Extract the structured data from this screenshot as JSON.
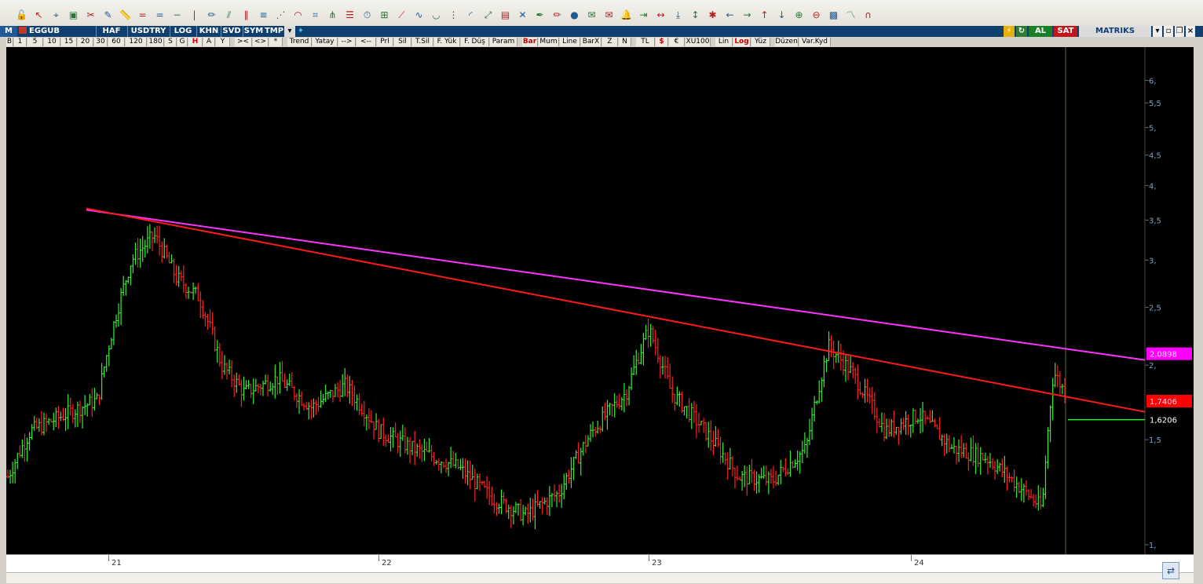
{
  "toolbar": {
    "icons": [
      "lock-open-icon",
      "cursor-icon",
      "cross-icon",
      "box-icon",
      "tools-icon",
      "pencil-icon",
      "ruler-icon",
      "equal-icon",
      "equal-icon",
      "minus-icon",
      "vline-icon",
      "brush-icon",
      "channel-icon",
      "parallel-icon",
      "fib-icon",
      "fib-fan-icon",
      "fib-arc-icon",
      "gann-icon",
      "pitch-icon",
      "retrace-icon",
      "time-icon",
      "grid-icon",
      "speed-icon",
      "wave-icon",
      "cycle-icon",
      "fan-icon",
      "arc-icon",
      "regression-icon",
      "box-zone-icon",
      "cross-lines-icon",
      "pen-icon",
      "brush-icon",
      "marker-icon",
      "note-icon",
      "note2-icon",
      "bell-icon",
      "collapse-h-icon",
      "expand-h-icon",
      "collapse-v-icon",
      "expand-v-icon",
      "star-icon",
      "arrow-left-icon",
      "arrow-right-icon",
      "arrow-up-icon",
      "arrow-down-icon",
      "zoom-in-icon",
      "zoom-out-icon",
      "image-icon",
      "wave-red-icon",
      "arc-red-icon"
    ]
  },
  "titlebar": {
    "m_label": "M",
    "symbol": "EGGUB",
    "period": "HAF",
    "currency": "USDTRY",
    "scale": "LOG",
    "khn": "KHN",
    "svd": "SVD",
    "sym": "SYM",
    "tmp": "TMP",
    "buy": "AL",
    "sell": "SAT",
    "brand": "MATRIKS"
  },
  "params": {
    "buttons": [
      "B",
      "1",
      "5",
      "10",
      "15",
      "20",
      "30",
      "60",
      "120",
      "180",
      "S",
      "G",
      "H",
      "A",
      "Y",
      "><",
      "<>",
      "*",
      "Trend",
      "Yatay",
      "-->",
      "<--",
      "Prl",
      "Sil",
      "T.Sil",
      "F. Yük",
      "F. Düş",
      "Param",
      "Bar",
      "Mum",
      "Line",
      "BarX",
      "Z",
      "N",
      "TL",
      "$",
      "€",
      "XU100",
      "Lin",
      "Log",
      "Yüz",
      "Düzen",
      "Var.Kyd"
    ]
  },
  "chart_data": {
    "type": "bar",
    "symbol": "EGGUB",
    "period": "weekly",
    "scale": "log",
    "ylim": [
      1.0,
      6.5
    ],
    "yticks": [
      "6,",
      "5,5",
      "5,",
      "4,5",
      "4,",
      "3,5",
      "3,",
      "2,5",
      "2,",
      "1,5",
      "1,"
    ],
    "xlabels": [
      "21",
      "22",
      "23",
      "24"
    ],
    "price_labels": [
      {
        "value": "2,0898",
        "color": "#ff00ff"
      },
      {
        "value": "1,7406",
        "color": "#ff0000"
      },
      {
        "value": "1,6206",
        "color": "#00cc00"
      }
    ],
    "trendlines": [
      {
        "name": "magenta",
        "color": "#ff33ff",
        "from": [
          0,
          3.64
        ],
        "to": [
          1,
          2.04
        ]
      },
      {
        "name": "red",
        "color": "#ff1a1a",
        "from": [
          0,
          3.66
        ],
        "to": [
          1,
          1.67
        ]
      }
    ],
    "up_color": "#33ee33",
    "down_color": "#ff2020"
  }
}
